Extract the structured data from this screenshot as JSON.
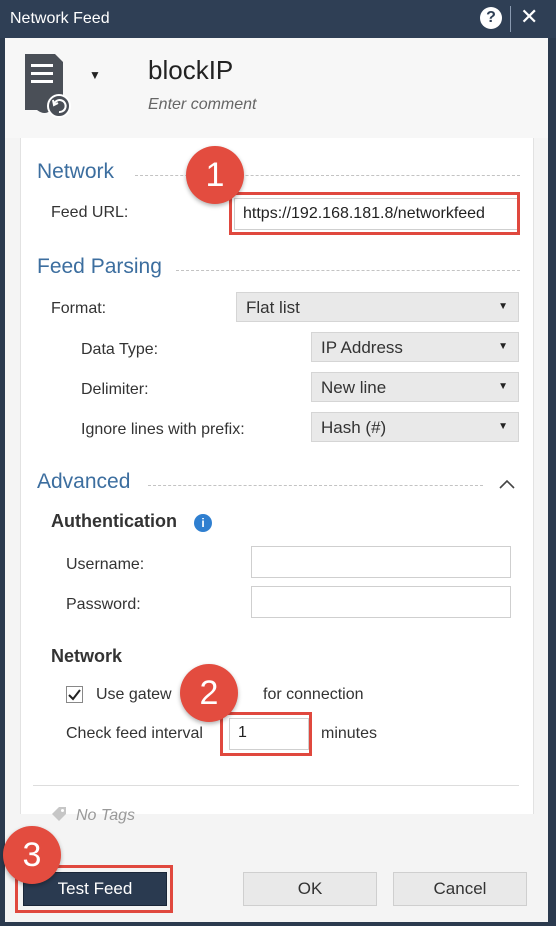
{
  "window": {
    "title": "Network Feed"
  },
  "header": {
    "name": "blockIP",
    "comment": "Enter comment"
  },
  "network": {
    "section": "Network",
    "feed_url_label": "Feed URL:",
    "feed_url_value": "https://192.168.181.8/networkfeed"
  },
  "parsing": {
    "section": "Feed Parsing",
    "format_label": "Format:",
    "format_value": "Flat list",
    "data_type_label": "Data Type:",
    "data_type_value": "IP Address",
    "delimiter_label": "Delimiter:",
    "delimiter_value": "New line",
    "ignore_label": "Ignore lines with prefix:",
    "ignore_value": "Hash (#)"
  },
  "advanced": {
    "section": "Advanced",
    "auth_heading": "Authentication",
    "username_label": "Username:",
    "password_label": "Password:",
    "network_heading": "Network",
    "gateway_label_a": "Use gatew",
    "gateway_label_b": "for connection",
    "gateway_checked": true,
    "interval_label": "Check feed interval",
    "interval_value": "1",
    "minutes_label": "minutes"
  },
  "tags": {
    "placeholder": "No Tags"
  },
  "buttons": {
    "test": "Test Feed",
    "ok": "OK",
    "cancel": "Cancel"
  },
  "badges": [
    "1",
    "2",
    "3"
  ]
}
